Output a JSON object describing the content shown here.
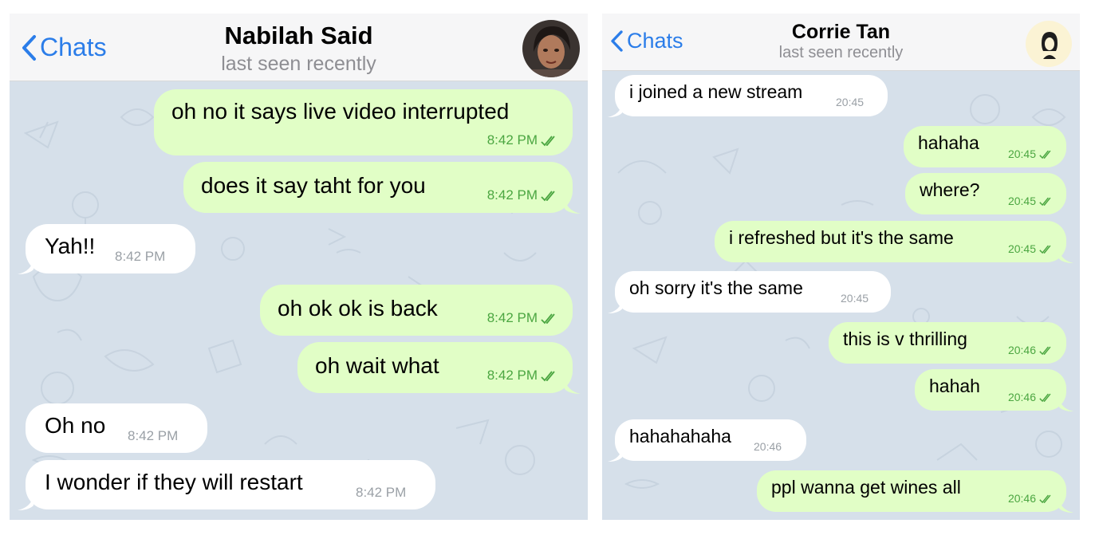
{
  "left_chat": {
    "back_label": "Chats",
    "contact_name": "Nabilah Said",
    "status": "last seen recently",
    "messages": [
      {
        "dir": "out",
        "text": "oh no it says live video interrupted",
        "time": "8:42 PM"
      },
      {
        "dir": "out",
        "text": "does it say taht for you",
        "time": "8:42 PM"
      },
      {
        "dir": "in",
        "text": "Yah!!",
        "time": "8:42 PM"
      },
      {
        "dir": "out",
        "text": "oh ok ok is back",
        "time": "8:42 PM"
      },
      {
        "dir": "out",
        "text": "oh wait what",
        "time": "8:42 PM"
      },
      {
        "dir": "in",
        "text": "Oh no",
        "time": "8:42 PM"
      },
      {
        "dir": "in",
        "text": "I wonder if they will restart",
        "time": "8:42 PM"
      }
    ]
  },
  "right_chat": {
    "back_label": "Chats",
    "contact_name": "Corrie Tan",
    "status": "last seen recently",
    "messages": [
      {
        "dir": "in",
        "text": "i joined a new stream",
        "time": "20:45"
      },
      {
        "dir": "out",
        "text": "hahaha",
        "time": "20:45"
      },
      {
        "dir": "out",
        "text": "where?",
        "time": "20:45"
      },
      {
        "dir": "out",
        "text": "i refreshed but it's the same",
        "time": "20:45"
      },
      {
        "dir": "in",
        "text": "oh sorry it's the same",
        "time": "20:45"
      },
      {
        "dir": "out",
        "text": "this is v thrilling",
        "time": "20:46"
      },
      {
        "dir": "out",
        "text": "hahah",
        "time": "20:46"
      },
      {
        "dir": "in",
        "text": "hahahahaha",
        "time": "20:46"
      },
      {
        "dir": "out",
        "text": "ppl wanna get wines all",
        "time": "20:46"
      }
    ]
  },
  "icons": {
    "back": "chevron-left-icon",
    "read_receipt": "double-check-icon"
  },
  "colors": {
    "accent": "#2b7de9",
    "outgoing_bubble": "#e1fec6",
    "incoming_bubble": "#ffffff",
    "outgoing_meta": "#4ba641",
    "incoming_meta": "#9aa0a6",
    "wallpaper": "#d6e0ea",
    "header": "#f6f6f7"
  }
}
